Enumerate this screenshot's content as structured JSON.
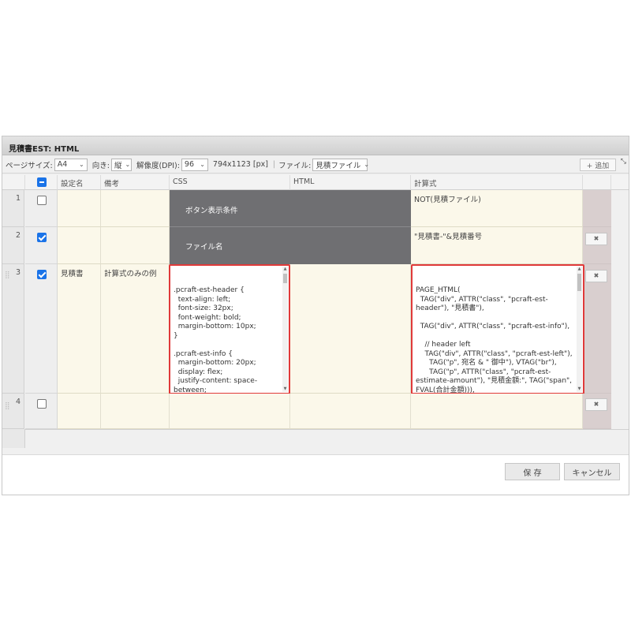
{
  "window": {
    "title": "見積書EST: HTML"
  },
  "toolbar": {
    "page_size_label": "ページサイズ:",
    "page_size_value": "A4",
    "orientation_label": "向き:",
    "orientation_value": "縦",
    "dpi_label": "解像度(DPI):",
    "dpi_value": "96",
    "dimensions": "794x1123 [px]",
    "separator": "|",
    "file_label": "ファイル:",
    "file_value": "見積ファイル",
    "add_button": "+ 追加",
    "expand_icon": "⤡"
  },
  "table": {
    "headers": {
      "name": "設定名",
      "note": "備考",
      "css": "CSS",
      "html": "HTML",
      "formula": "計算式"
    },
    "rows": [
      {
        "num": "1",
        "checked": false,
        "name": "",
        "note": "",
        "merged_label": "ボタン表示条件",
        "formula": "NOT(見積ファイル)"
      },
      {
        "num": "2",
        "checked": true,
        "name": "",
        "note": "",
        "merged_label": "ファイル名",
        "formula": "\"見積書-\"&見積番号",
        "delete": "✖"
      },
      {
        "num": "3",
        "checked": true,
        "name": "見積書",
        "note": "計算式のみの例",
        "css": ".pcraft-est-header {\n  text-align: left;\n  font-size: 32px;\n  font-weight: bold;\n  margin-bottom: 10px;\n}\n\n.pcraft-est-info {\n  margin-bottom: 20px;\n  display: flex;\n  justify-content: space-between;\n  flex-wrap: wrap;\n  align-items: flex-start;\n}",
        "formula": "PAGE_HTML(\n  TAG(\"div\", ATTR(\"class\", \"pcraft-est-header\"), \"見積書\"),\n\n  TAG(\"div\", ATTR(\"class\", \"pcraft-est-info\"),\n\n    // header left\n    TAG(\"div\", ATTR(\"class\", \"pcraft-est-left\"),\n      TAG(\"p\", 宛名 & \" 御中\"), VTAG(\"br\"),\n      TAG(\"p\", ATTR(\"class\", \"pcraft-est-estimate-amount\"), \"見積金額:\", TAG(\"span\", FVAL(合計金額))),\n      TAG(\"p\", ATTR(\"class\", \"pcraft-est-validity\"),\n        \"見積の有効期限: \" & DATE_FORMAT(見積",
        "delete": "✖"
      },
      {
        "num": "4",
        "checked": false,
        "name": "",
        "note": "",
        "formula": "",
        "delete": "✖"
      }
    ]
  },
  "footer": {
    "save": "保 存",
    "cancel": "キャンセル"
  }
}
